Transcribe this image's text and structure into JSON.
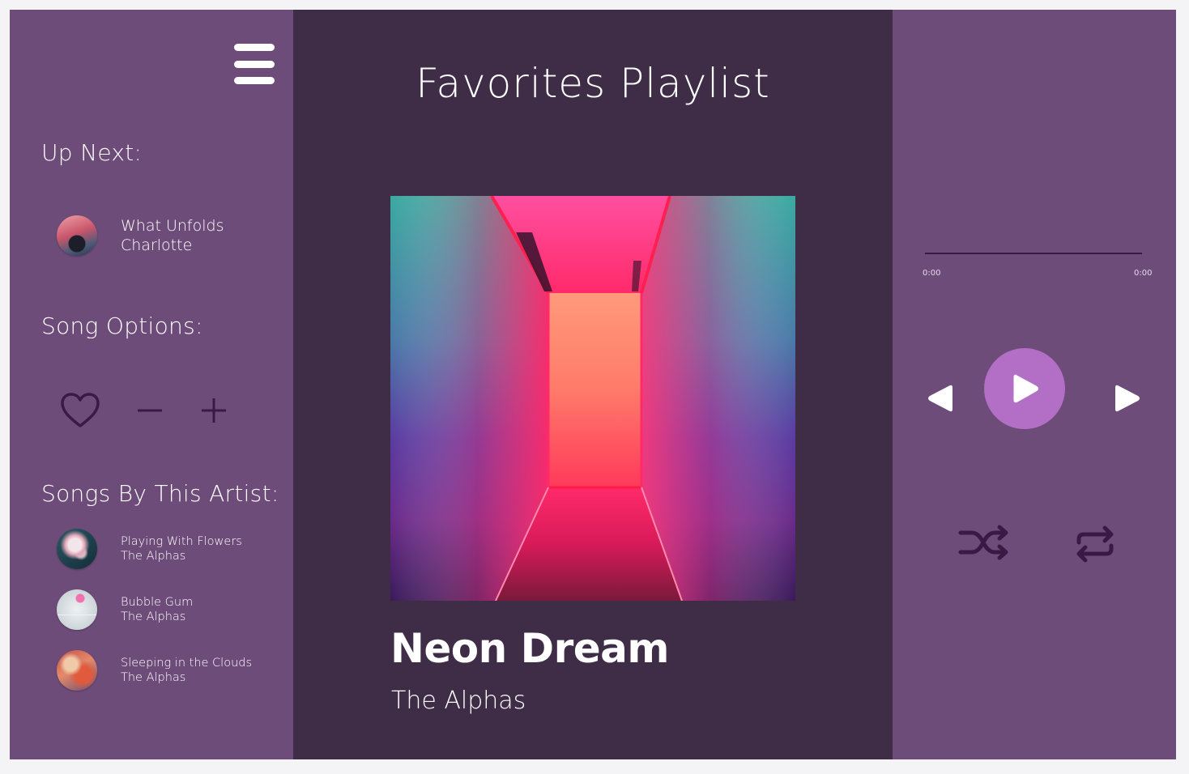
{
  "playlist": {
    "title": "Favorites Playlist"
  },
  "up_next": {
    "heading": "Up Next:",
    "song": {
      "title": "What Unfolds",
      "artist": "Charlotte"
    }
  },
  "song_options": {
    "heading": "Song Options:",
    "icons": [
      "heart-icon",
      "minus-icon",
      "plus-icon"
    ]
  },
  "artist_songs": {
    "heading": "Songs By This Artist:",
    "items": [
      {
        "title": "Playing With Flowers",
        "artist": "The Alphas"
      },
      {
        "title": "Bubble Gum",
        "artist": "The Alphas"
      },
      {
        "title": "Sleeping in the Clouds",
        "artist": "The Alphas"
      }
    ]
  },
  "now_playing": {
    "title": "Neon Dream",
    "artist": "The Alphas"
  },
  "player": {
    "progress": 0,
    "time_elapsed": "0:00",
    "time_total": "0:00",
    "controls": [
      "previous-icon",
      "play-icon",
      "next-icon",
      "shuffle-icon",
      "repeat-icon"
    ]
  },
  "colors": {
    "side_panel": "#6e4c79",
    "center_panel": "#3f2c47",
    "accent": "#b36fc6",
    "icon_dark": "#3a1a45"
  }
}
